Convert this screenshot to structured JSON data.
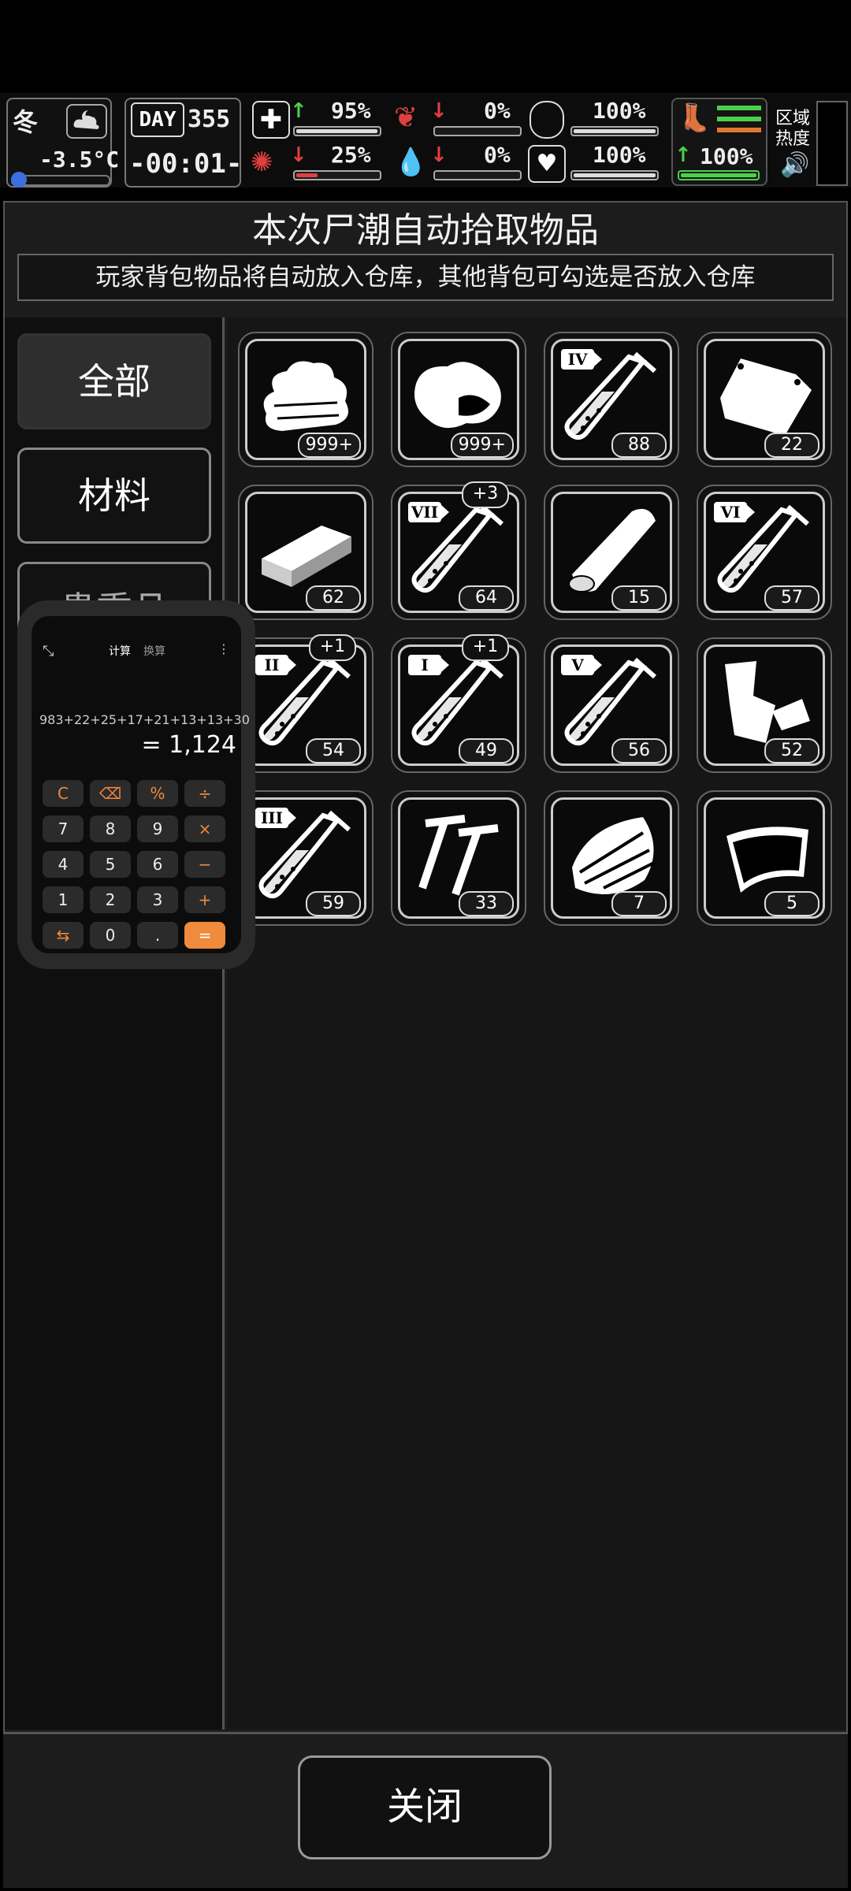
{
  "hud": {
    "season": "冬",
    "temperature": "-3.5°C",
    "day_label": "DAY",
    "day_number": "355",
    "clock": "-00:01-",
    "stats": [
      {
        "name": "health",
        "value": "95%",
        "level": 0.95,
        "trend": "up",
        "color": "#dddddd"
      },
      {
        "name": "hunger",
        "value": "0%",
        "level": 0.0,
        "trend": "down",
        "color": "#dddddd"
      },
      {
        "name": "armor",
        "value": "100%",
        "level": 1.0,
        "trend": "none",
        "color": "#dddddd"
      },
      {
        "name": "brain",
        "value": "25%",
        "level": 0.25,
        "trend": "down",
        "color": "#e04040"
      },
      {
        "name": "thirst",
        "value": "0%",
        "level": 0.0,
        "trend": "down",
        "color": "#dddddd"
      },
      {
        "name": "mood",
        "value": "100%",
        "level": 1.0,
        "trend": "none",
        "color": "#dddddd"
      },
      {
        "name": "stamina",
        "value": "100%",
        "level": 1.0,
        "trend": "up",
        "color": "#4cd04c"
      }
    ],
    "area_heat_label": "区域\n热度"
  },
  "dialog": {
    "title": "本次尸潮自动拾取物品",
    "subtitle": "玩家背包物品将自动放入仓库，其他背包可勾选是否放入仓库",
    "close_label": "关闭"
  },
  "categories": [
    {
      "label": "全部",
      "selected": true
    },
    {
      "label": "材料",
      "selected": false
    },
    {
      "label": "贵重品",
      "selected": false
    }
  ],
  "items": [
    {
      "icon": "cloth-icon",
      "count": "999+",
      "bonus": ""
    },
    {
      "icon": "meat-icon",
      "count": "999+",
      "bonus": ""
    },
    {
      "icon": "test-tube-iv-icon",
      "count": "88",
      "bonus": "",
      "tier": "IV"
    },
    {
      "icon": "bag-icon",
      "count": "22",
      "bonus": ""
    },
    {
      "icon": "plank-icon",
      "count": "62",
      "bonus": ""
    },
    {
      "icon": "test-tube-vii-icon",
      "count": "64",
      "bonus": "+3",
      "tier": "VII"
    },
    {
      "icon": "log-icon",
      "count": "15",
      "bonus": ""
    },
    {
      "icon": "test-tube-vi-icon",
      "count": "57",
      "bonus": "",
      "tier": "VI"
    },
    {
      "icon": "test-tube-ii-icon",
      "count": "54",
      "bonus": "+1",
      "tier": "II"
    },
    {
      "icon": "test-tube-i-icon",
      "count": "49",
      "bonus": "+1",
      "tier": "I"
    },
    {
      "icon": "test-tube-v-icon",
      "count": "56",
      "bonus": "",
      "tier": "V"
    },
    {
      "icon": "scrap-icon",
      "count": "52",
      "bonus": ""
    },
    {
      "icon": "test-tube-iii-icon",
      "count": "59",
      "bonus": "",
      "tier": "III"
    },
    {
      "icon": "nails-icon",
      "count": "33",
      "bonus": ""
    },
    {
      "icon": "bark-icon",
      "count": "7",
      "bonus": ""
    },
    {
      "icon": "fabric-sheet-icon",
      "count": "5",
      "bonus": ""
    }
  ],
  "calculator": {
    "tab_calc": "计算",
    "tab_convert": "换算",
    "expression": "983+22+25+17+21+13+13+30",
    "result": "= 1,124",
    "keys": [
      [
        "C",
        "⌫",
        "%",
        "÷"
      ],
      [
        "7",
        "8",
        "9",
        "×"
      ],
      [
        "4",
        "5",
        "6",
        "−"
      ],
      [
        "1",
        "2",
        "3",
        "+"
      ],
      [
        "⇆",
        "0",
        ".",
        "="
      ]
    ]
  }
}
